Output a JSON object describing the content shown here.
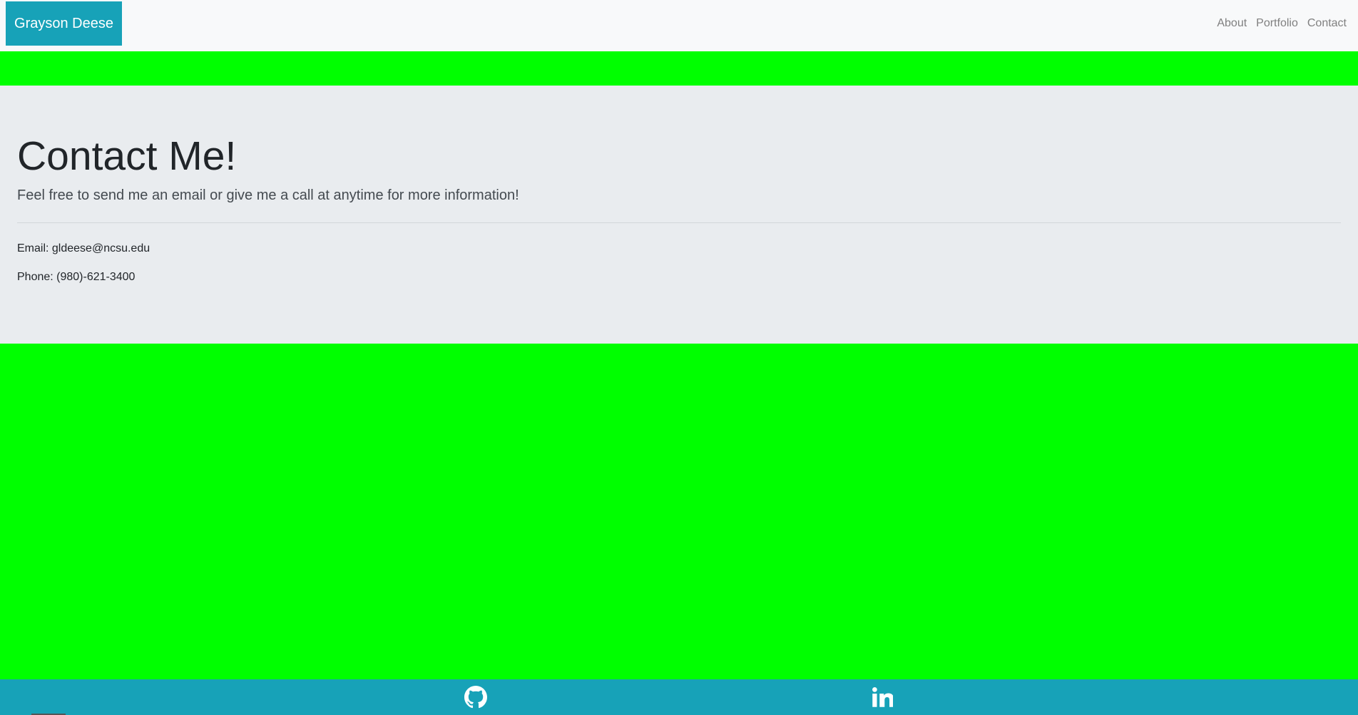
{
  "navbar": {
    "brand": "Grayson Deese",
    "links": [
      {
        "label": "About"
      },
      {
        "label": "Portfolio"
      },
      {
        "label": "Contact"
      }
    ]
  },
  "contact": {
    "title": "Contact Me!",
    "lead": "Feel free to send me an email or give me a call at anytime for more information!",
    "email": "Email: gldeese@ncsu.edu",
    "phone": "Phone: (980)-621-3400"
  },
  "footer": {
    "icons": [
      "github-icon",
      "linkedin-icon"
    ]
  },
  "colors": {
    "brand": "#17a2b8",
    "page_background": "#00ff00",
    "jumbotron": "#e9ecef",
    "navbar": "#f8f9fa"
  }
}
